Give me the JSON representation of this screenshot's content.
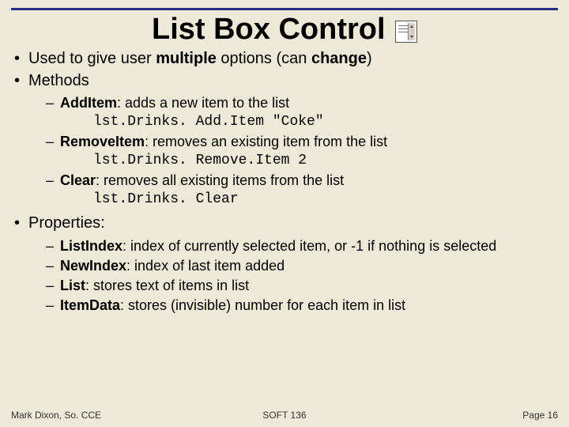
{
  "title": "List Box Control",
  "bullets": {
    "b0": {
      "t0": "Used to give user ",
      "t1": "multiple",
      "t2": " options (can ",
      "t3": "change",
      "t4": ")"
    },
    "b1": "Methods",
    "b2": "Properties:"
  },
  "methods": {
    "m0": {
      "name": "AddItem",
      "desc": ": adds a new item to the list",
      "code": "lst.Drinks. Add.Item \"Coke\""
    },
    "m1": {
      "name": "RemoveItem",
      "desc": ": removes an existing item from the list",
      "code": "lst.Drinks. Remove.Item 2"
    },
    "m2": {
      "name": "Clear",
      "desc": ": removes all existing items from the list",
      "code": "lst.Drinks. Clear"
    }
  },
  "props": {
    "p0": {
      "name": "ListIndex",
      "desc": ": index of currently selected item, or -1 if nothing is selected"
    },
    "p1": {
      "name": "NewIndex",
      "desc": ": index of last item added"
    },
    "p2": {
      "name": "List",
      "desc": ": stores text of items in list"
    },
    "p3": {
      "name": "ItemData",
      "desc": ": stores (invisible) number for each item in list"
    }
  },
  "footer": {
    "left": "Mark Dixon, So. CCE",
    "center": "SOFT 136",
    "right": "Page 16"
  }
}
